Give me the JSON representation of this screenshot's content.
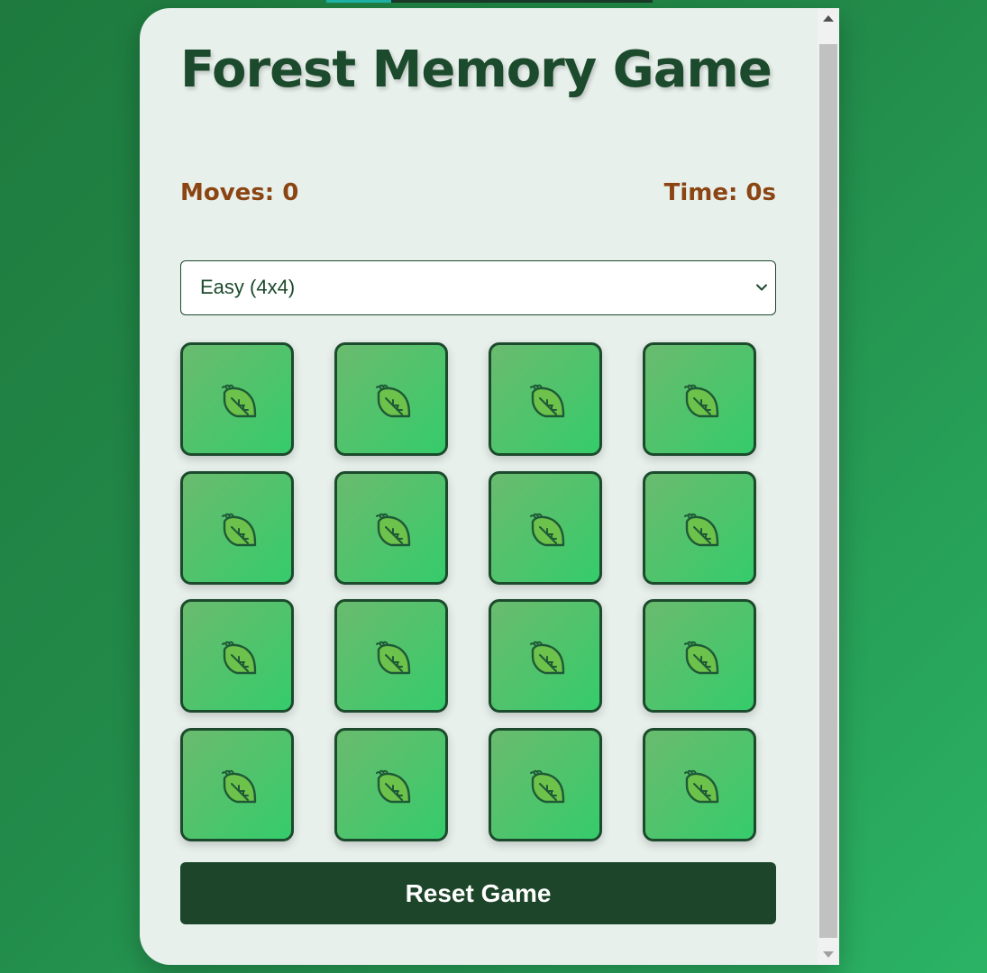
{
  "game": {
    "title": "Forest Memory Game",
    "stats": {
      "moves_label": "Moves: 0",
      "time_label": "Time: 0s"
    },
    "difficulty": {
      "selected": "Easy (4x4)"
    },
    "board": {
      "rows": 4,
      "cols": 4,
      "card_back_icon": "leaf-icon",
      "all_face_down": true
    },
    "reset_label": "Reset Game"
  },
  "colors": {
    "title": "#1c4a2c",
    "stats": "#8b4513",
    "card_border": "#1c4a2c",
    "card_fill": "#4ec46c",
    "reset_button": "#1c4529",
    "background": "#228b4a"
  }
}
